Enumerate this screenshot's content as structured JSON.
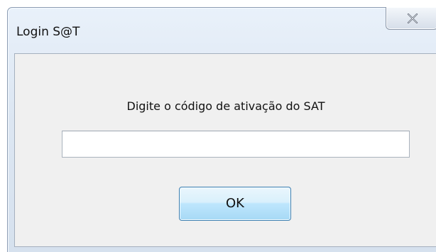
{
  "window": {
    "title": "Login S@T"
  },
  "titlebar": {
    "close_icon": "close-icon"
  },
  "form": {
    "prompt": "Digite o código de ativação do SAT",
    "activation_code": {
      "value": "",
      "placeholder": ""
    },
    "ok_label": "OK"
  },
  "colors": {
    "frame": "#dde7f3",
    "client_background": "#f0f0f0",
    "ok_button_border": "#3c7fb1",
    "ok_button_fill": "#bee6fd"
  }
}
